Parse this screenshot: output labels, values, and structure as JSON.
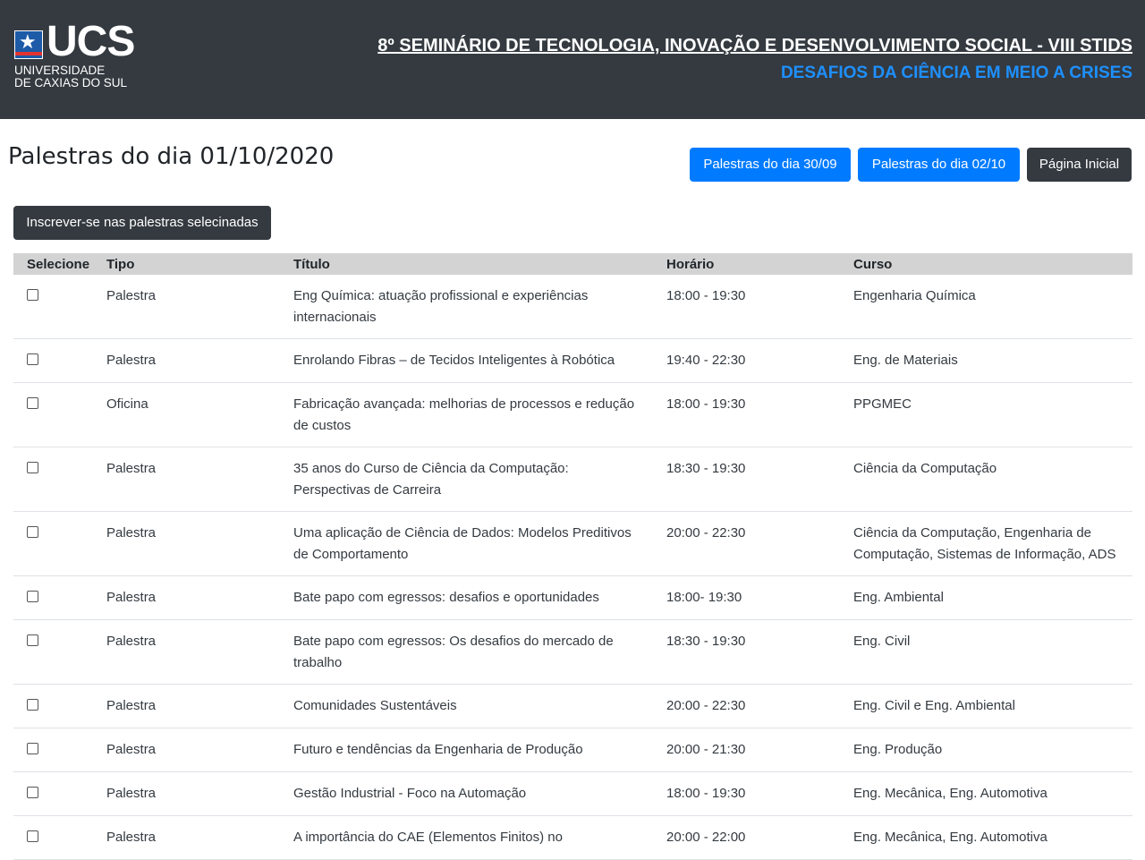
{
  "header": {
    "logo_text": "UCS",
    "logo_line1": "UNIVERSIDADE",
    "logo_line2": "DE CAXIAS DO SUL",
    "title": "8º SEMINÁRIO DE TECNOLOGIA, INOVAÇÃO E DESENVOLVIMENTO SOCIAL - VIII STIDS",
    "subtitle": "DESAFIOS DA CIÊNCIA EM MEIO A CRISES"
  },
  "page": {
    "title": "Palestras do dia 01/10/2020",
    "btn_prev": "Palestras do dia 30/09",
    "btn_next": "Palestras do dia 02/10",
    "btn_home": "Página Inicial",
    "btn_subscribe": "Inscrever-se nas palestras selecinadas"
  },
  "colors": {
    "header_bg": "#343a40",
    "accent": "#007bff",
    "subtitle": "#1e90ff",
    "table_head_bg": "#d3d3d3"
  },
  "table": {
    "headers": [
      "Selecione",
      "Tipo",
      "Título",
      "Horário",
      "Curso"
    ],
    "rows": [
      {
        "tipo": "Palestra",
        "titulo": "Eng Química: atuação profissional e experiências internacionais",
        "horario": "18:00 - 19:30",
        "curso": "Engenharia Química"
      },
      {
        "tipo": "Palestra",
        "titulo": "Enrolando Fibras – de Tecidos Inteligentes à Robótica",
        "horario": "19:40 - 22:30",
        "curso": "Eng. de Materiais"
      },
      {
        "tipo": "Oficina",
        "titulo": "Fabricação avançada: melhorias de processos e redução de custos",
        "horario": "18:00 - 19:30",
        "curso": "PPGMEC"
      },
      {
        "tipo": "Palestra",
        "titulo": "35 anos do Curso de Ciência da Computação: Perspectivas de Carreira",
        "horario": "18:30 - 19:30",
        "curso": "Ciência da Computação"
      },
      {
        "tipo": "Palestra",
        "titulo": "Uma aplicação de Ciência de Dados: Modelos Preditivos de Comportamento",
        "horario": "20:00 - 22:30",
        "curso": "Ciência da Computação, Engenharia de Computação, Sistemas de Informação, ADS"
      },
      {
        "tipo": "Palestra",
        "titulo": "Bate papo com egressos: desafios e oportunidades",
        "horario": "18:00- 19:30",
        "curso": "Eng. Ambiental"
      },
      {
        "tipo": "Palestra",
        "titulo": "Bate papo com egressos: Os desafios do mercado de trabalho",
        "horario": "18:30 - 19:30",
        "curso": "Eng. Civil"
      },
      {
        "tipo": "Palestra",
        "titulo": "Comunidades Sustentáveis",
        "horario": "20:00 - 22:30",
        "curso": "Eng. Civil e Eng. Ambiental"
      },
      {
        "tipo": "Palestra",
        "titulo": "Futuro e tendências da Engenharia de Produção",
        "horario": "20:00 - 21:30",
        "curso": "Eng. Produção"
      },
      {
        "tipo": "Palestra",
        "titulo": "Gestão Industrial - Foco na Automação",
        "horario": "18:00 - 19:30",
        "curso": "Eng. Mecânica, Eng. Automotiva"
      },
      {
        "tipo": "Palestra",
        "titulo": "A importância do CAE (Elementos Finitos) no",
        "horario": "20:00 - 22:00",
        "curso": "Eng. Mecânica, Eng. Automotiva"
      }
    ]
  }
}
